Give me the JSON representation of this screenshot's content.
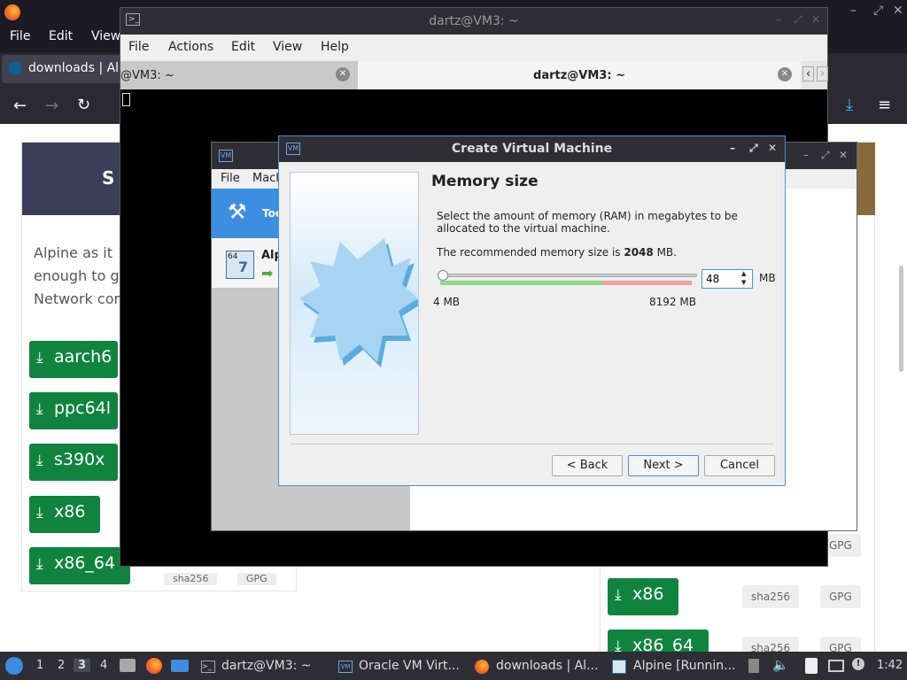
{
  "firefox": {
    "menu": [
      "File",
      "Edit",
      "View"
    ],
    "tab_label": "downloads | Alp",
    "site_banner_text": "S",
    "intro_lines": [
      "Alpine as it",
      "enough to g",
      "Network cor"
    ],
    "left_buttons": [
      "aarch6",
      "ppc64l",
      "s390x",
      "x86",
      "x86_64"
    ],
    "left_chips": [
      "sha256",
      "GPG"
    ],
    "right_rows": [
      {
        "label": "x86",
        "sha": "sha256",
        "gpg": "GPG"
      },
      {
        "label": "x86_64",
        "sha": "sha256",
        "gpg": "GPG"
      }
    ],
    "right_gpg_labels": [
      "GPG"
    ]
  },
  "terminal": {
    "title": "dartz@VM3: ~",
    "menu": [
      "File",
      "Actions",
      "Edit",
      "View",
      "Help"
    ],
    "tabs": [
      "@VM3: ~",
      "dartz@VM3: ~"
    ]
  },
  "vbox_manager": {
    "menu": [
      "File",
      "Mach"
    ],
    "tools_label": "Too",
    "vm_name": "Alp",
    "vm_badge": "64"
  },
  "dialog": {
    "title": "Create Virtual Machine",
    "heading": "Memory size",
    "description": "Select the amount of memory (RAM) in megabytes to be allocated to the virtual machine.",
    "recommend_prefix": "The recommended memory size is ",
    "recommend_value": "2048",
    "recommend_suffix": " MB.",
    "slider_min_label": "4 MB",
    "slider_max_label": "8192 MB",
    "slider_fraction": 0.005,
    "memory_value": "48",
    "unit": "MB",
    "back_label": "< Back",
    "next_label": "Next >",
    "cancel_label": "Cancel",
    "accent_color": "#4a8ed8"
  },
  "taskbar": {
    "workspaces": [
      "1",
      "2",
      "3",
      "4"
    ],
    "tasks": [
      "dartz@VM3: ~",
      "Oracle VM Virt...",
      "downloads | Al...",
      "Alpine [Runnin..."
    ],
    "clock": "1:42"
  }
}
